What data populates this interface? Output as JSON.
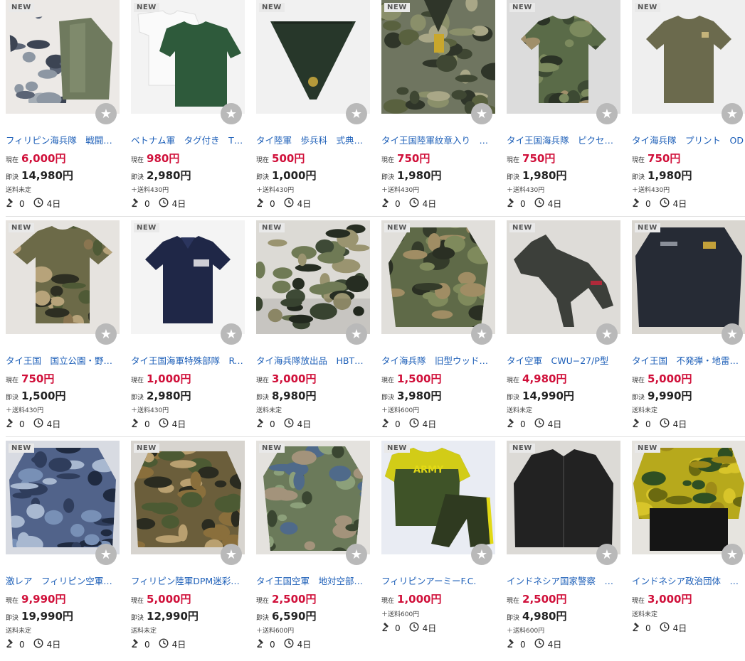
{
  "labels": {
    "new": "NEW",
    "current": "現在",
    "buy_now": "即決"
  },
  "rows": [
    [
      {
        "title": "フィリピン海兵隊　戦闘服・迷彩",
        "current": "6,000円",
        "buy_now": "14,980円",
        "shipping": "送料未定",
        "bids": "0",
        "time": "4日",
        "image": "camo-uniform-blue-green"
      },
      {
        "title": "ベトナム軍　タグ付き　Tシャツ",
        "current": "980円",
        "buy_now": "2,980円",
        "shipping": "＋送料430円",
        "bids": "0",
        "time": "4日",
        "image": "t-shirts-white-green"
      },
      {
        "title": "タイ陸軍　歩兵科　式典用スカーフ",
        "current": "500円",
        "buy_now": "1,000円",
        "shipping": "＋送料430円",
        "bids": "0",
        "time": "4日",
        "image": "dark-green-scarf"
      },
      {
        "title": "タイ王国陸軍紋章入り　ピクセル",
        "current": "750円",
        "buy_now": "1,980円",
        "shipping": "＋送料430円",
        "bids": "0",
        "time": "4日",
        "image": "digital-camo-shirt"
      },
      {
        "title": "タイ王国海兵隊　ピクセル迷彩",
        "current": "750円",
        "buy_now": "1,980円",
        "shipping": "＋送料430円",
        "bids": "0",
        "time": "4日",
        "image": "camo-t-shirt"
      },
      {
        "title": "タイ海兵隊　プリント　OD",
        "current": "750円",
        "buy_now": "1,980円",
        "shipping": "＋送料430円",
        "bids": "0",
        "time": "4日",
        "image": "olive-t-shirt"
      }
    ],
    [
      {
        "title": "タイ王国　国立公園・野生動物",
        "current": "750円",
        "buy_now": "1,500円",
        "shipping": "＋送料430円",
        "bids": "0",
        "time": "4日",
        "image": "woodland-camo-shirt"
      },
      {
        "title": "タイ王国海軍特殊部隊　RTN",
        "current": "1,000円",
        "buy_now": "2,980円",
        "shipping": "＋送料430円",
        "bids": "0",
        "time": "4日",
        "image": "navy-polo-shirt"
      },
      {
        "title": "タイ海兵隊放出品　HBT生地",
        "current": "3,000円",
        "buy_now": "8,980円",
        "shipping": "送料未定",
        "bids": "0",
        "time": "4日",
        "image": "camo-jacket-pants"
      },
      {
        "title": "タイ海兵隊　旧型ウッドランド",
        "current": "1,500円",
        "buy_now": "3,980円",
        "shipping": "＋送料600円",
        "bids": "0",
        "time": "4日",
        "image": "woodland-jacket"
      },
      {
        "title": "タイ空軍　CWU−27/P型",
        "current": "4,980円",
        "buy_now": "14,990円",
        "shipping": "送料未定",
        "bids": "0",
        "time": "4日",
        "image": "flight-suit"
      },
      {
        "title": "タイ王国　不発弾・地雷除去",
        "current": "5,000円",
        "buy_now": "9,990円",
        "shipping": "送料未定",
        "bids": "0",
        "time": "4日",
        "image": "dark-uniform"
      }
    ],
    [
      {
        "title": "激レア　フィリピン空軍　迷彩",
        "current": "9,990円",
        "buy_now": "19,990円",
        "shipping": "送料未定",
        "bids": "0",
        "time": "4日",
        "image": "blue-camo-uniform"
      },
      {
        "title": "フィリピン陸軍DPM迷彩　上下",
        "current": "5,000円",
        "buy_now": "12,990円",
        "shipping": "送料未定",
        "bids": "0",
        "time": "4日",
        "image": "dpm-camo-uniform"
      },
      {
        "title": "タイ王国空軍　地対空部隊　迷彩",
        "current": "2,500円",
        "buy_now": "6,590円",
        "shipping": "＋送料600円",
        "bids": "0",
        "time": "4日",
        "image": "camo-uniform-hanging"
      },
      {
        "title": "フィリピンアーミーF.C.",
        "current": "1,000円",
        "buy_now": "",
        "shipping": "＋送料600円",
        "bids": "0",
        "time": "4日",
        "image": "army-jersey"
      },
      {
        "title": "インドネシア国家警察　防寒",
        "current": "2,500円",
        "buy_now": "4,980円",
        "shipping": "＋送料600円",
        "bids": "0",
        "time": "4日",
        "image": "black-jacket"
      },
      {
        "title": "インドネシア政治団体　ゴルカル",
        "current": "3,000円",
        "buy_now": "",
        "shipping": "送料未定",
        "bids": "0",
        "time": "4日",
        "image": "yellow-camo-uniform"
      }
    ]
  ]
}
